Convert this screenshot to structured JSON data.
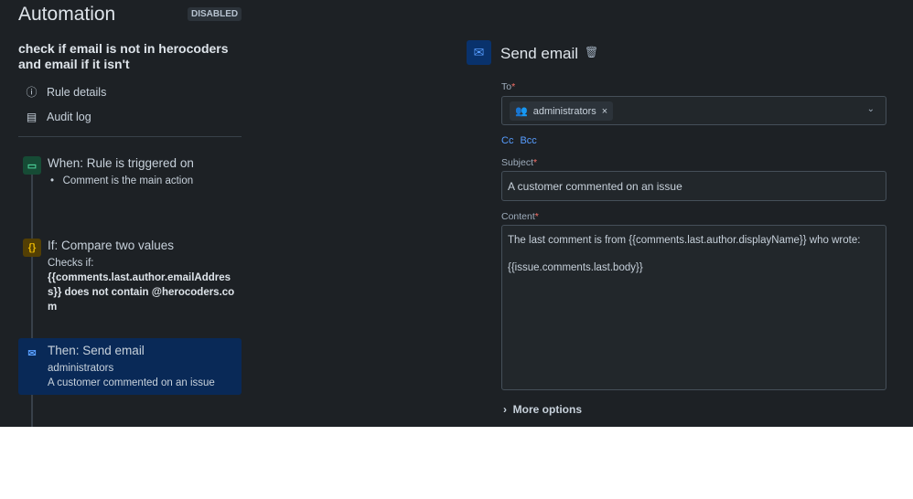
{
  "app": {
    "title": "Automation",
    "status_badge": "DISABLED"
  },
  "rule": {
    "name": "check if email is not in herocoders and email if it isn't"
  },
  "nav": [
    {
      "label": "Rule details",
      "icon": "info-icon"
    },
    {
      "label": "Audit log",
      "icon": "document-icon"
    }
  ],
  "steps": {
    "trigger": {
      "title": "When: Rule is triggered on",
      "bullet": "Comment is the main action",
      "color": "#1f845a"
    },
    "condition": {
      "title": "If: Compare two values",
      "line1": "Checks if:",
      "line2": "{{comments.last.author.emailAddress}} does not contain @herocoders.com",
      "color": "#7f5f01"
    },
    "action": {
      "title": "Then: Send email",
      "line1": "administrators",
      "line2": "A customer commented on an issue"
    }
  },
  "panel": {
    "title": "Send email",
    "to_label": "To",
    "required": "*",
    "to_value": "administrators",
    "remove": "×",
    "cc": "Cc",
    "bcc": "Bcc",
    "subject_label": "Subject",
    "subject_value": "A customer commented on an issue",
    "content_label": "Content",
    "content_line1": "The last comment is from {{comments.last.author.displayName}} who wrote:",
    "content_line2": "{{issue.comments.last.body}}",
    "more_options": "More options"
  }
}
